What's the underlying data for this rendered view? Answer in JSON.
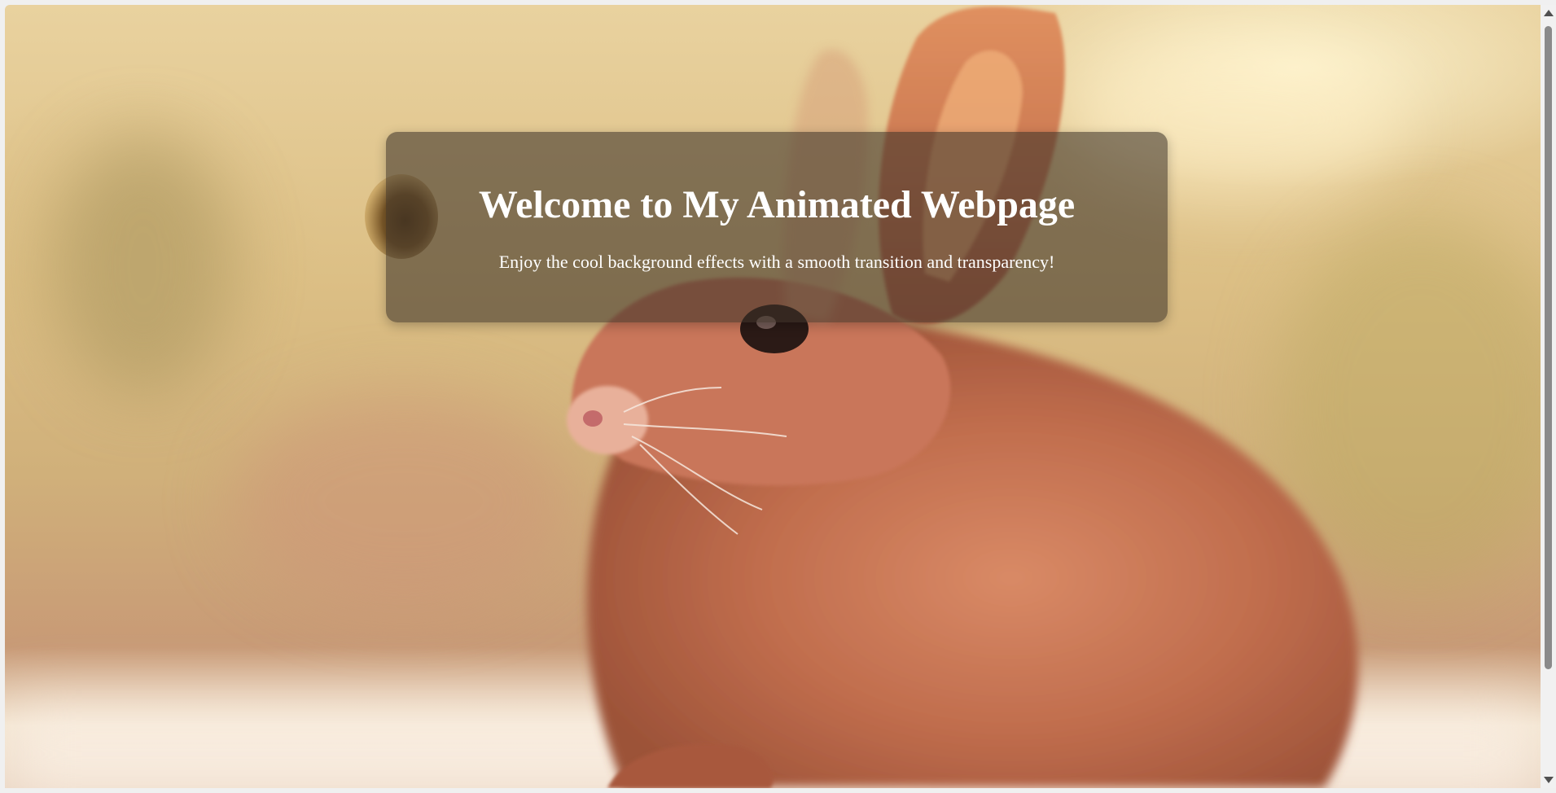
{
  "hero": {
    "title": "Welcome to My Animated Webpage",
    "subtitle": "Enjoy the cool background effects with a smooth transition and transparency!"
  },
  "background": {
    "image": "rabbit-photo",
    "icons": [
      "bee-icon"
    ]
  },
  "colors": {
    "card_overlay": "#3c3228",
    "text": "#ffffff",
    "scroll_thumb": "#8a8a8a"
  }
}
